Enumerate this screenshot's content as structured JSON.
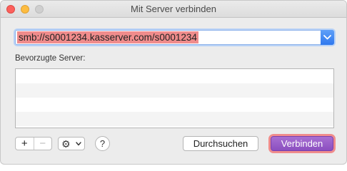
{
  "window": {
    "title": "Mit Server verbinden"
  },
  "address": {
    "value": "smb://s0001234.kasserver.com/s0001234"
  },
  "favorites": {
    "label": "Bevorzugte Server:",
    "items": []
  },
  "toolbar": {
    "add_label": "+",
    "remove_label": "−",
    "help_label": "?"
  },
  "buttons": {
    "browse_label": "Durchsuchen",
    "connect_label": "Verbinden"
  },
  "colors": {
    "accent": "#8b4fc0",
    "highlight": "#f08c8c",
    "combo_button": "#3b82f0"
  }
}
